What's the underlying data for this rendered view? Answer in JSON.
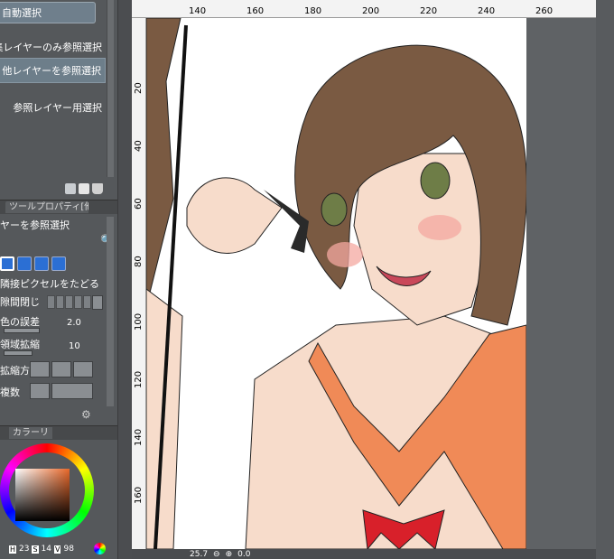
{
  "selection_layer": {
    "auto_select_label": "自動選択",
    "items": [
      {
        "label": "編集レイヤーのみ参照選択",
        "selected": false
      },
      {
        "label": "他レイヤーを参照選択",
        "selected": true
      },
      {
        "label": "参照レイヤー用選択",
        "selected": false
      }
    ]
  },
  "tool_property": {
    "title": "ツールプロパティ[他レ",
    "tool_name": "ヤーを参照選択",
    "follow_adjacent": "隣接ピクセルをたどる",
    "close_gap": "隙間閉じ",
    "tolerance_label": "色の誤差",
    "tolerance_value": "2.0",
    "expand_label": "領域拡縮",
    "expand_value": "10",
    "method_label": "拡縮方",
    "target_label": "複数"
  },
  "color_panel": {
    "title": "カラーリ",
    "h_key": "H",
    "h_value": "23",
    "s_key": "S",
    "s_value": "14",
    "v_key": "V",
    "v_value": "98",
    "main_color": "#e8682a"
  },
  "ruler": {
    "top_labels": [
      "140",
      "160",
      "180",
      "200",
      "220",
      "240",
      "260"
    ],
    "left_labels": [
      "20",
      "40",
      "60",
      "80",
      "100",
      "120",
      "140",
      "160"
    ]
  },
  "status": {
    "zoom": "25.7",
    "rotation": "0.0"
  },
  "colors": {
    "panel_bg": "#55585b",
    "hair": "#7a5a42",
    "skin": "#f7dccb",
    "collar": "#f08a57",
    "ribbon": "#d8202a",
    "eye": "#6e7d47"
  }
}
